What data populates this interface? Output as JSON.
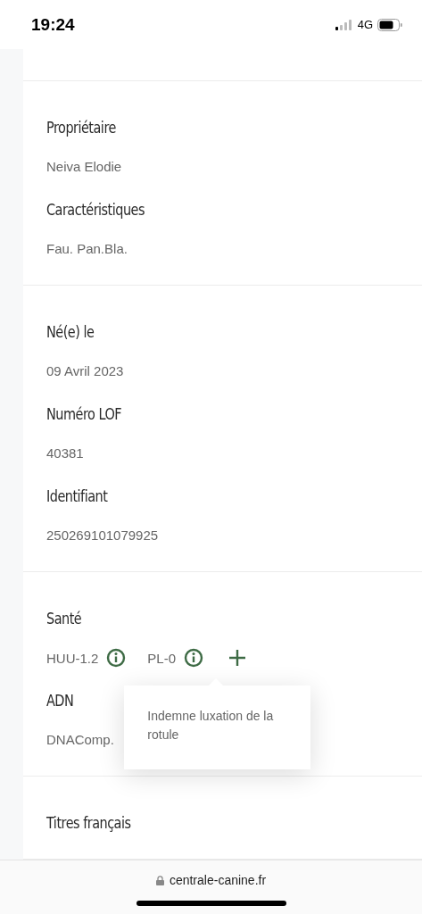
{
  "status_bar": {
    "time": "19:24",
    "network": "4G"
  },
  "sections": [
    {
      "fields": [
        {
          "kind": "text",
          "label": "Propriétaire",
          "value": "Neiva Elodie"
        },
        {
          "kind": "text",
          "label": "Caractéristiques",
          "value": "Fau. Pan.Bla."
        }
      ]
    },
    {
      "fields": [
        {
          "kind": "text",
          "label": "Né(e) le",
          "value": "09 Avril 2023"
        },
        {
          "kind": "text",
          "label": "Numéro LOF",
          "value": "40381"
        },
        {
          "kind": "text",
          "label": "Identifiant",
          "value": "250269101079925"
        }
      ]
    },
    {
      "fields": [
        {
          "kind": "health",
          "label": "Santé",
          "items": [
            {
              "code": "HUU-1.2"
            },
            {
              "code": "PL-0",
              "tooltip": "Indemne luxation de la rotule"
            }
          ]
        },
        {
          "kind": "text",
          "label": "ADN",
          "value": "DNAComp."
        }
      ]
    },
    {
      "fields": [
        {
          "kind": "heading",
          "label": "Titres français"
        }
      ]
    }
  ],
  "browser_bar": {
    "url": "centrale-canine.fr"
  }
}
